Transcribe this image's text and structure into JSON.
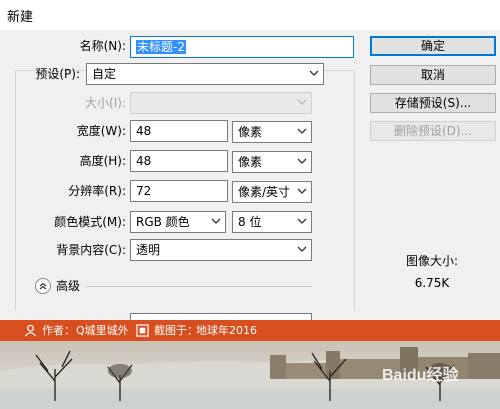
{
  "window": {
    "title": "新建"
  },
  "form": {
    "name_label": "名称(N):",
    "name_value": "未标题-2",
    "preset_label": "预设(P):",
    "preset_value": "自定",
    "size_label": "大小(I):",
    "width_label": "宽度(W):",
    "width_value": "48",
    "width_unit": "像素",
    "height_label": "高度(H):",
    "height_value": "48",
    "height_unit": "像素",
    "resolution_label": "分辨率(R):",
    "resolution_value": "72",
    "resolution_unit": "像素/英寸",
    "color_mode_label": "颜色模式(M):",
    "color_mode_value": "RGB 颜色",
    "bit_depth_value": "8 位",
    "background_label": "背景内容(C):",
    "background_value": "透明",
    "advanced_label": "高级"
  },
  "buttons": {
    "ok": "确定",
    "cancel": "取消",
    "save_preset": "存储预设(S)...",
    "delete_preset": "删除预设(D)..."
  },
  "image_size": {
    "label": "图像大小:",
    "value": "6.75K"
  },
  "banner": {
    "author_prefix": "作者：",
    "author": "Q城里城外",
    "shot_prefix": "截图于：",
    "shot_place": "地球年2016"
  },
  "watermark": "Baidu经验",
  "colors": {
    "accent": "#0078d7",
    "banner": "#d94e1f",
    "selection": "#3390ff"
  }
}
